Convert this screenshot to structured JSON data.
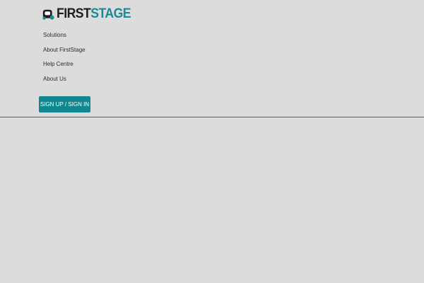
{
  "brand": {
    "name_first": "FIRST",
    "name_second": "STAGE",
    "logo_icon": "stage-mask-icon",
    "colors": {
      "dark": "#1c1c1c",
      "accent": "#1a8a98"
    }
  },
  "nav": {
    "items": [
      {
        "label": "Solutions"
      },
      {
        "label": "About FirstStage"
      },
      {
        "label": "Help Centre"
      },
      {
        "label": "About Us"
      }
    ]
  },
  "auth": {
    "signup_label": "SIGN UP / SIGN IN",
    "button_color": "#13878f"
  },
  "theme": {
    "background": "#dcdcdc",
    "divider": "#5b5b5b"
  }
}
